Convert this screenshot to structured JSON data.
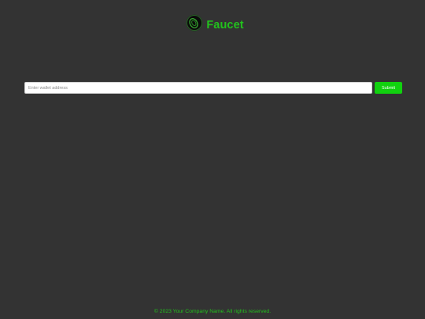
{
  "header": {
    "title": "Faucet",
    "logo_icon": "faucet-coin-logo"
  },
  "form": {
    "wallet_placeholder": "Enter wallet address",
    "wallet_value": "",
    "submit_label": "Submit"
  },
  "footer": {
    "copyright": "© 2023 Your Company Name. All rights reserved."
  },
  "colors": {
    "background": "#333333",
    "accent": "#22c11d",
    "button": "#11d10f"
  }
}
